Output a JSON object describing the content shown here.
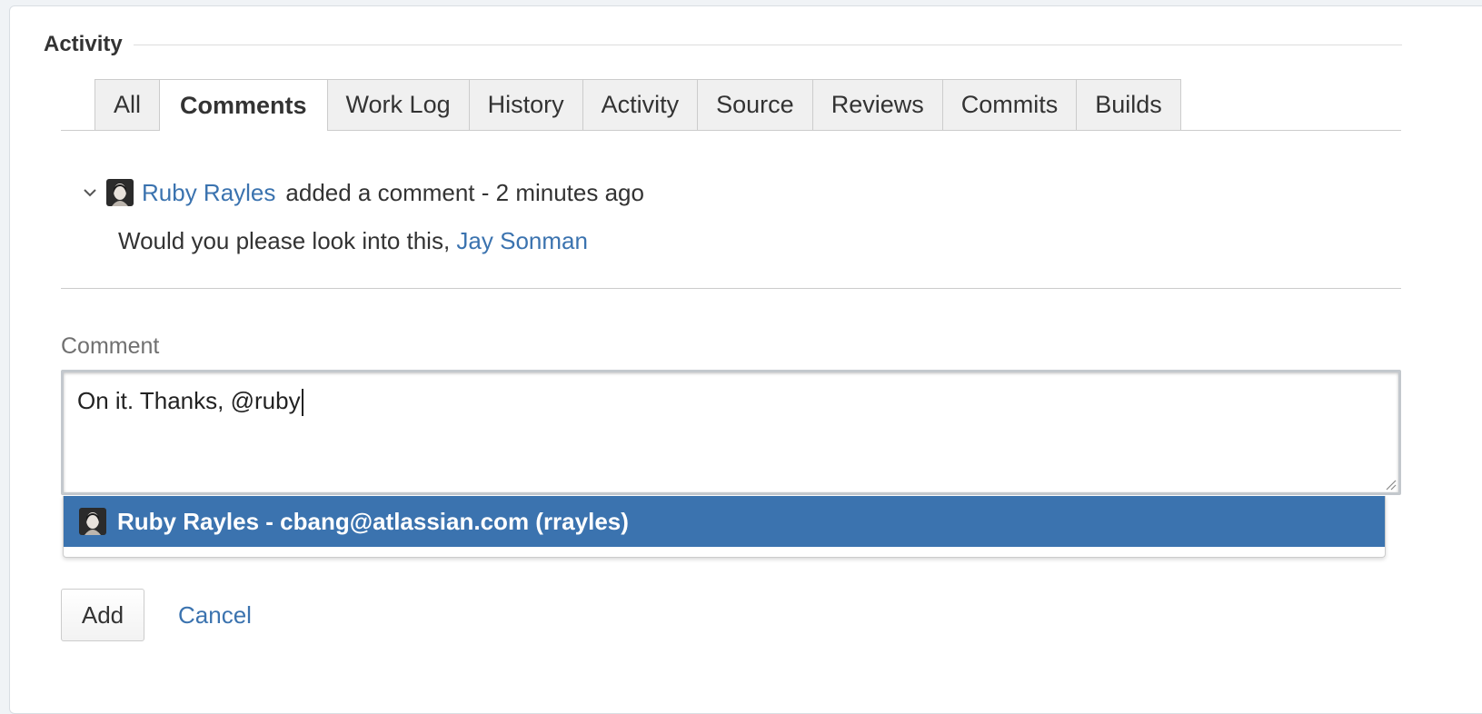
{
  "module": {
    "title": "Activity"
  },
  "tabs": [
    {
      "label": "All",
      "active": false
    },
    {
      "label": "Comments",
      "active": true
    },
    {
      "label": "Work Log",
      "active": false
    },
    {
      "label": "History",
      "active": false
    },
    {
      "label": "Activity",
      "active": false
    },
    {
      "label": "Source",
      "active": false
    },
    {
      "label": "Reviews",
      "active": false
    },
    {
      "label": "Commits",
      "active": false
    },
    {
      "label": "Builds",
      "active": false
    }
  ],
  "comment": {
    "author": "Ruby Rayles",
    "action": "added a comment - 2 minutes ago",
    "body_text": "Would you please look into this,",
    "mention": "Jay Sonman"
  },
  "comment_form": {
    "label": "Comment",
    "value": "On it. Thanks, @ruby",
    "suggestion": {
      "match": "Ruby",
      "rest": " Rayles - cbang@atlassian.com (rrayles)"
    },
    "add_label": "Add",
    "cancel_label": "Cancel"
  },
  "icons": {
    "collapse": "chevron-down-icon",
    "avatar": "user-avatar-icon"
  },
  "colors": {
    "link": "#3b73af",
    "highlight": "#3b73af"
  }
}
